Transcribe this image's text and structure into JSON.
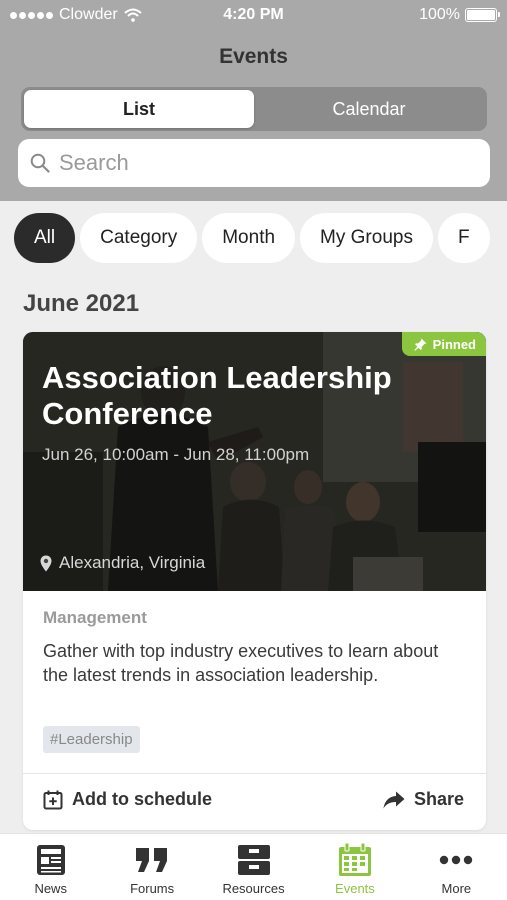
{
  "status_bar": {
    "carrier": "Clowder",
    "time": "4:20 PM",
    "battery": "100%"
  },
  "header": {
    "title": "Events"
  },
  "view_toggle": {
    "list_label": "List",
    "calendar_label": "Calendar",
    "selected": "List"
  },
  "search": {
    "placeholder": "Search",
    "value": ""
  },
  "filters": [
    {
      "label": "All",
      "active": true
    },
    {
      "label": "Category",
      "active": false
    },
    {
      "label": "Month",
      "active": false
    },
    {
      "label": "My Groups",
      "active": false
    },
    {
      "label": "F",
      "active": false
    }
  ],
  "section": {
    "month_heading": "June 2021"
  },
  "event": {
    "pinned_label": "Pinned",
    "title": "Association Leadership Conference",
    "date_range": "Jun 26, 10:00am - Jun 28, 11:00pm",
    "location": "Alexandria, Virginia",
    "category": "Management",
    "description": "Gather with top industry executives to learn about the latest trends in association leadership.",
    "tag": "#Leadership",
    "add_label": "Add to schedule",
    "share_label": "Share"
  },
  "tabbar": [
    {
      "label": "News",
      "icon": "news-icon",
      "active": false
    },
    {
      "label": "Forums",
      "icon": "forums-icon",
      "active": false
    },
    {
      "label": "Resources",
      "icon": "resources-icon",
      "active": false
    },
    {
      "label": "Events",
      "icon": "events-icon",
      "active": true
    },
    {
      "label": "More",
      "icon": "more-icon",
      "active": false
    }
  ],
  "colors": {
    "accent": "#8cc63f",
    "header_bg": "#a9a9a9",
    "chip_active": "#2b2b2b"
  }
}
